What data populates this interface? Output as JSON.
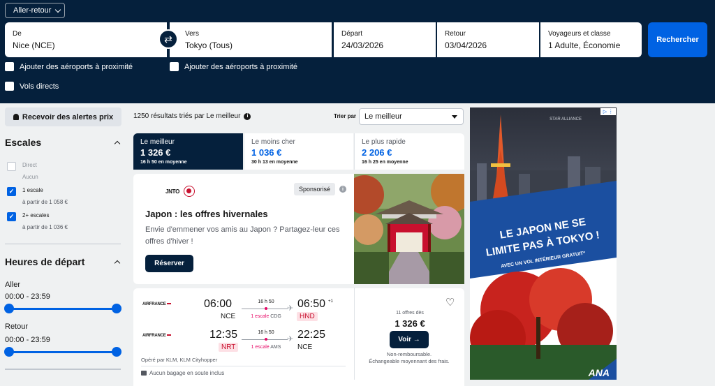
{
  "header": {
    "trip_type": "Aller-retour",
    "from": {
      "label": "De",
      "value": "Nice (NCE)"
    },
    "to": {
      "label": "Vers",
      "value": "Tokyo (Tous)"
    },
    "depart": {
      "label": "Départ",
      "value": "24/03/2026"
    },
    "return": {
      "label": "Retour",
      "value": "03/04/2026"
    },
    "travellers": {
      "label": "Voyageurs et classe",
      "value": "1 Adulte, Économie"
    },
    "search_label": "Rechercher",
    "nearby_from": "Ajouter des aéroports à proximité",
    "nearby_to": "Ajouter des aéroports à proximité",
    "direct_only": "Vols directs"
  },
  "sidebar": {
    "alerts_label": "Recevoir des alertes prix",
    "stops_title": "Escales",
    "stops": [
      {
        "label": "Direct",
        "sub": "Aucun",
        "checked": false
      },
      {
        "label": "1 escale",
        "sub": "à partir de 1 058 €",
        "checked": true
      },
      {
        "label": "2+ escales",
        "sub": "à partir de 1 036 €",
        "checked": true
      }
    ],
    "times_title": "Heures de départ",
    "outbound": {
      "label": "Aller",
      "range": "00:00 - 23:59"
    },
    "inbound": {
      "label": "Retour",
      "range": "00:00 - 23:59"
    }
  },
  "results": {
    "count_text": "1250 résultats triés par Le meilleur",
    "sort_label": "Trier par",
    "sort_value": "Le meilleur",
    "tabs": [
      {
        "title": "Le meilleur",
        "price": "1 326 €",
        "duration": "16 h 50 en moyenne"
      },
      {
        "title": "Le moins cher",
        "price": "1 036 €",
        "duration": "30 h 13 en moyenne"
      },
      {
        "title": "Le plus rapide",
        "price": "2 206 €",
        "duration": "16 h 25 en moyenne"
      }
    ]
  },
  "promo": {
    "brand1": "JNTO",
    "badge": "Sponsorisé",
    "title": "Japon : les offres hivernales",
    "description": "Envie d'emmener vos amis au Japon ? Partagez-leur ces offres d'hiver !",
    "cta": "Réserver"
  },
  "flight": {
    "legs": [
      {
        "airline": "AIRFRANCE",
        "dep_time": "06:00",
        "dep_ap": "NCE",
        "duration": "16 h 50",
        "stops_count": "1 escale",
        "via": "CDG",
        "arr_time": "06:50",
        "day_offset": "+1",
        "arr_ap": "HND"
      },
      {
        "airline": "AIRFRANCE",
        "dep_time": "12:35",
        "dep_ap": "NRT",
        "duration": "16 h 50",
        "stops_count": "1 escale",
        "via": "AMS",
        "arr_time": "22:25",
        "day_offset": "",
        "arr_ap": "NCE"
      }
    ],
    "operated_by": "Opéré par KLM, KLM Cityhopper",
    "baggage": "Aucun bagage en soute inclus",
    "offers": "11 offres dès",
    "price": "1 326 €",
    "cta": "Voir →",
    "conditions": [
      "Non-remboursable.",
      "Échangeable moyennant des frais."
    ]
  },
  "ad": {
    "alliance": "STAR ALLIANCE",
    "headline_1": "LE JAPON NE SE",
    "headline_2": "LIMITE PAS À TOKYO !",
    "sub": "AVEC UN VOL INTÉRIEUR GRATUIT*",
    "logo": "ANA"
  }
}
